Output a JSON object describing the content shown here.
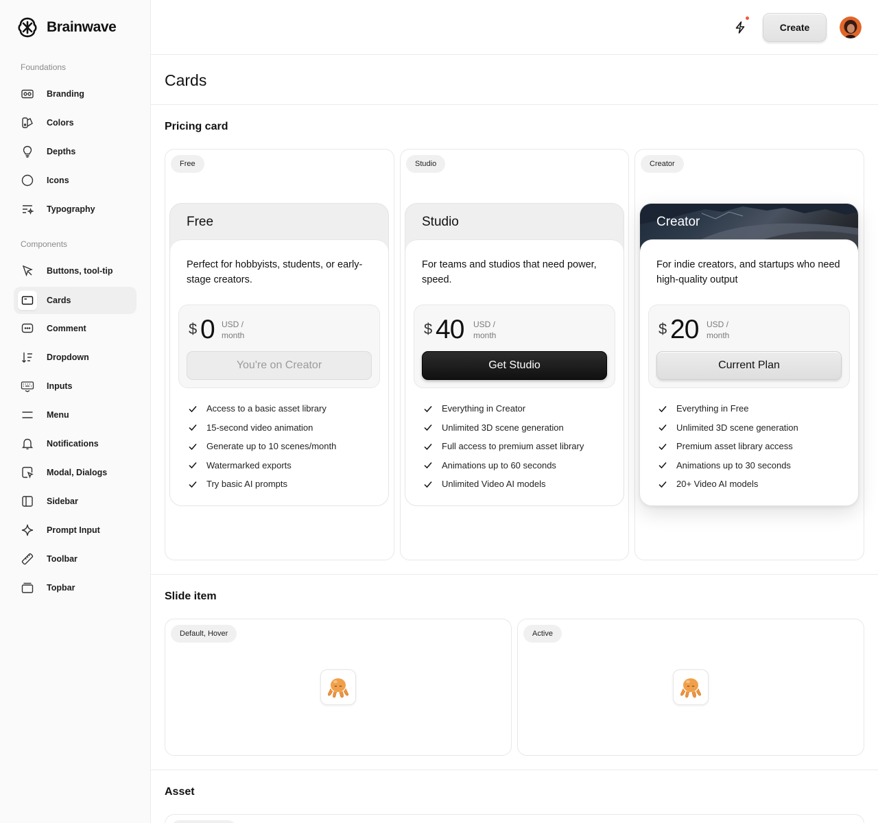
{
  "brand": {
    "name": "Brainwave"
  },
  "sidebar": {
    "sections": [
      {
        "title": "Foundations"
      },
      {
        "title": "Components"
      }
    ],
    "items": [
      {
        "label": "Branding",
        "icon": "branding-icon"
      },
      {
        "label": "Colors",
        "icon": "palette-icon"
      },
      {
        "label": "Depths",
        "icon": "lightbulb-icon"
      },
      {
        "label": "Icons",
        "icon": "circle-icon"
      },
      {
        "label": "Typography",
        "icon": "typography-icon"
      },
      {
        "label": "Buttons, tool-tip",
        "icon": "cursor-icon"
      },
      {
        "label": "Cards",
        "icon": "card-icon",
        "active": true
      },
      {
        "label": "Comment",
        "icon": "comment-icon"
      },
      {
        "label": "Dropdown",
        "icon": "sort-icon"
      },
      {
        "label": "Inputs",
        "icon": "keyboard-icon"
      },
      {
        "label": "Menu",
        "icon": "menu-icon"
      },
      {
        "label": "Notifications",
        "icon": "bell-icon"
      },
      {
        "label": "Modal, Dialogs",
        "icon": "modal-icon"
      },
      {
        "label": "Sidebar",
        "icon": "sidebar-icon"
      },
      {
        "label": "Prompt Input",
        "icon": "sparkle-icon"
      },
      {
        "label": "Toolbar",
        "icon": "ruler-icon"
      },
      {
        "label": "Topbar",
        "icon": "topbar-icon"
      }
    ]
  },
  "topbar": {
    "create_label": "Create",
    "notification_dot_color": "#f05a3a"
  },
  "page": {
    "title": "Cards",
    "sections": {
      "pricing": "Pricing card",
      "slide": "Slide item",
      "asset": "Asset"
    }
  },
  "pricing": {
    "cards": [
      {
        "tag": "Free",
        "name": "Free",
        "description": "Perfect for hobbyists, students, or early-stage creators.",
        "currency": "$",
        "amount": "0",
        "unit_line1": "USD /",
        "unit_line2": "month",
        "button": "You're on Creator",
        "features": [
          "Access to a basic asset library",
          "15-second video animation",
          "Generate up to 10 scenes/month",
          "Watermarked exports",
          "Try basic AI prompts"
        ]
      },
      {
        "tag": "Studio",
        "name": "Studio",
        "description": "For teams and studios that need power, speed.",
        "currency": "$",
        "amount": "40",
        "unit_line1": "USD /",
        "unit_line2": "month",
        "button": "Get Studio",
        "features": [
          "Everything in Creator",
          "Unlimited 3D scene generation",
          "Full access to premium asset library",
          "Animations up to 60 seconds",
          "Unlimited Video AI models"
        ]
      },
      {
        "tag": "Creator",
        "name": "Creator",
        "description": "For indie creators, and startups who need high-quality output",
        "currency": "$",
        "amount": "20",
        "unit_line1": "USD /",
        "unit_line2": "month",
        "button": "Current Plan",
        "features": [
          "Everything in Free",
          "Unlimited 3D scene generation",
          "Premium asset library access",
          "Animations up to 30 seconds",
          "20+ Video AI models"
        ]
      }
    ]
  },
  "slide": {
    "states": [
      {
        "tag": "Default, Hover"
      },
      {
        "tag": "Active"
      }
    ]
  }
}
